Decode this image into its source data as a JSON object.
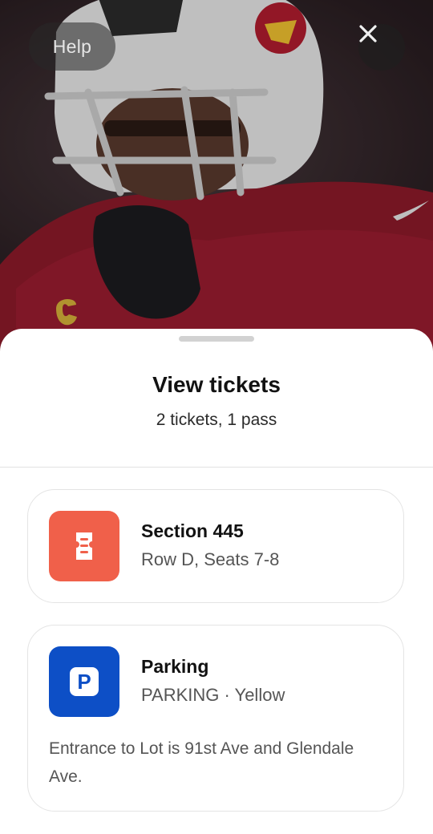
{
  "header": {
    "help_label": "Help",
    "close_icon": "close-icon"
  },
  "sheet": {
    "title": "View tickets",
    "subtitle": "2 tickets, 1 pass"
  },
  "cards": [
    {
      "icon": "ticket-icon",
      "icon_color": "#f0604a",
      "title": "Section 445",
      "subtitle": "Row D, Seats 7-8"
    },
    {
      "icon": "parking-icon",
      "icon_letter": "P",
      "icon_color": "#0d4fc6",
      "title": "Parking",
      "subtitle": "PARKING · Yellow",
      "note": "Entrance to Lot is 91st Ave and Glendale Ave."
    }
  ]
}
